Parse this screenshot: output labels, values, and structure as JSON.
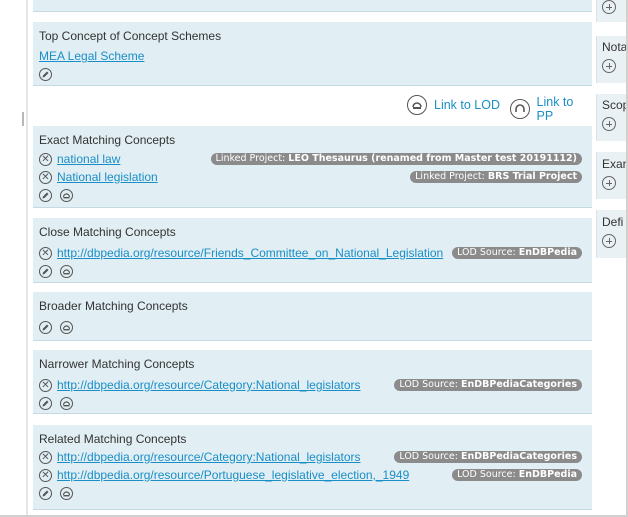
{
  "top_concept": {
    "title": "Top Concept of Concept Schemes",
    "link": "MEA Legal Scheme"
  },
  "linkbar": {
    "lod_label": "Link to LOD",
    "pp_label": "Link to PP"
  },
  "exact": {
    "title": "Exact Matching Concepts",
    "items": [
      {
        "label": "national law",
        "badge_prefix": "Linked Project:",
        "badge_value": "LEO Thesaurus (renamed from Master test 20191112)"
      },
      {
        "label": "National legislation",
        "badge_prefix": "Linked Project:",
        "badge_value": "BRS Trial Project"
      }
    ]
  },
  "close": {
    "title": "Close Matching Concepts",
    "items": [
      {
        "label": "http://dbpedia.org/resource/Friends_Committee_on_National_Legislation",
        "badge_prefix": "LOD Source:",
        "badge_value": "EnDBPedia"
      }
    ]
  },
  "broader": {
    "title": "Broader Matching Concepts"
  },
  "narrower": {
    "title": "Narrower Matching Concepts",
    "items": [
      {
        "label": "http://dbpedia.org/resource/Category:National_legislators",
        "badge_prefix": "LOD Source:",
        "badge_value": "EnDBPediaCategories"
      }
    ]
  },
  "related": {
    "title": "Related Matching Concepts",
    "items": [
      {
        "label": "http://dbpedia.org/resource/Category:National_legislators",
        "badge_prefix": "LOD Source:",
        "badge_value": "EnDBPediaCategories"
      },
      {
        "label": "http://dbpedia.org/resource/Portuguese_legislative_election,_1949",
        "badge_prefix": "LOD Source:",
        "badge_value": "EnDBPedia"
      }
    ]
  },
  "right_cards": [
    {
      "title": "Nota"
    },
    {
      "title": "Scop"
    },
    {
      "title": "Exar"
    },
    {
      "title": "Defi"
    }
  ],
  "icons": {
    "remove": "remove-circle-icon",
    "edit": "pencil-edit-icon",
    "lod": "lod-link-icon",
    "add": "plus-circle-icon"
  }
}
